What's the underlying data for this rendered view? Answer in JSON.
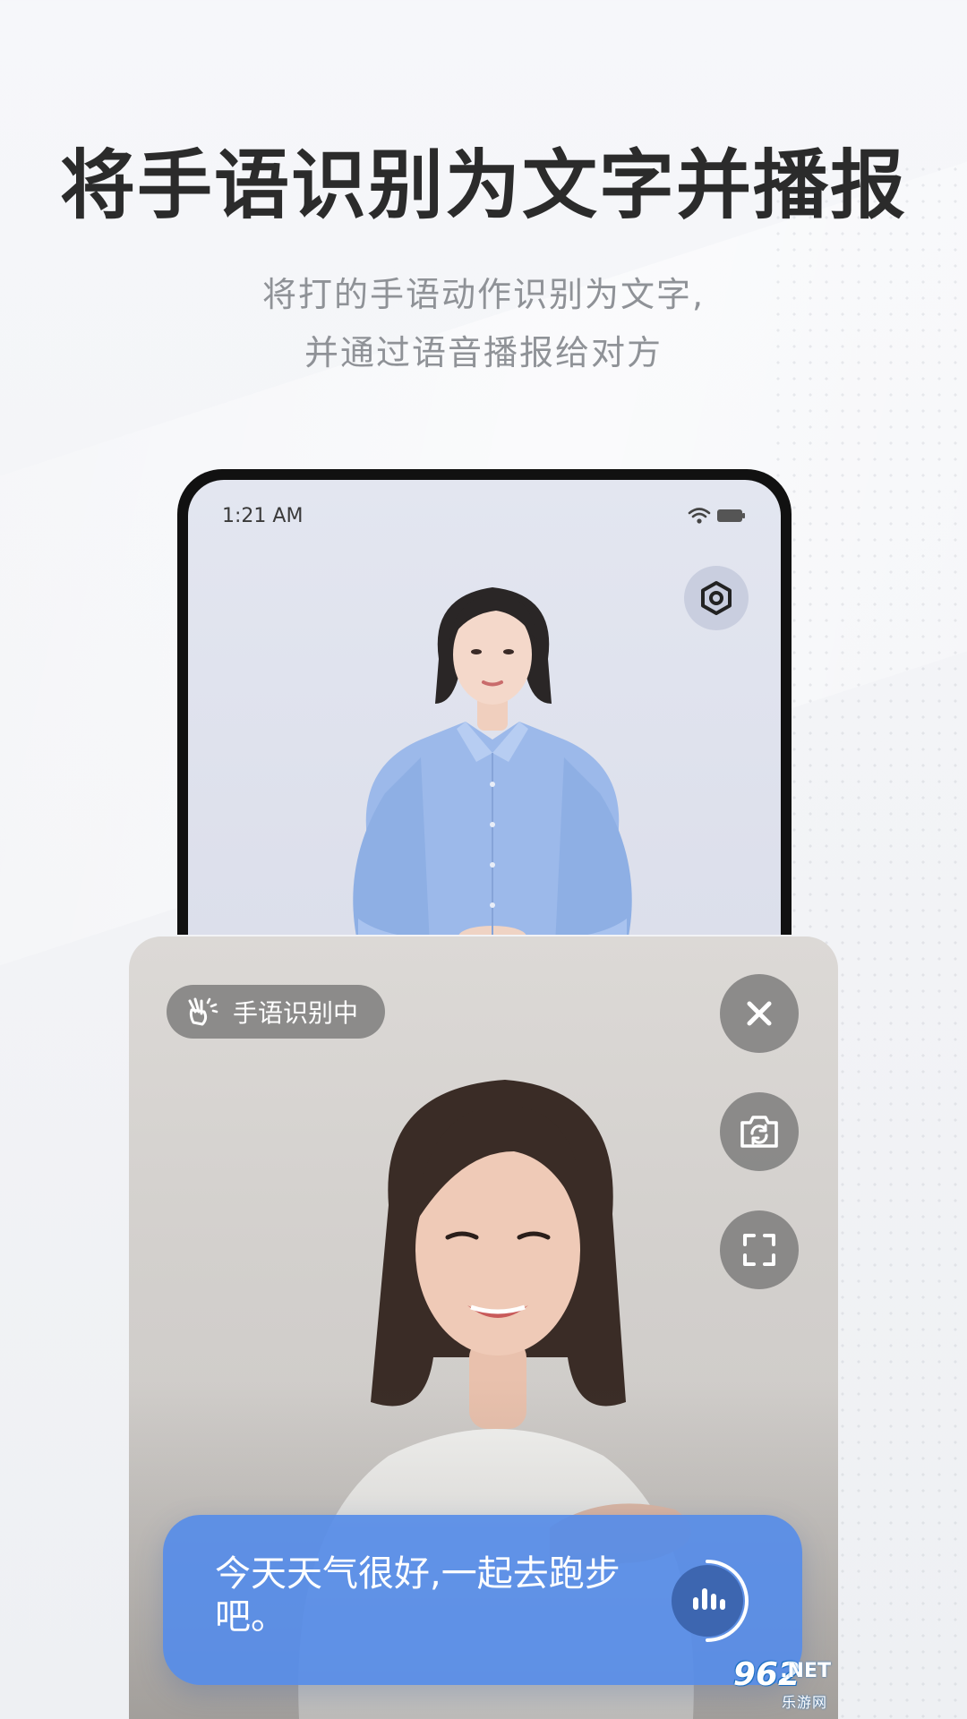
{
  "headline": "将手语识别为文字并播报",
  "subtitle": {
    "line1": "将打的手语动作识别为文字,",
    "line2": "并通过语音播报给对方"
  },
  "phone": {
    "status_time": "1:21 AM",
    "icons": [
      "wifi-icon",
      "battery-icon",
      "settings-icon"
    ]
  },
  "camera": {
    "status_label": "手语识别中",
    "buttons": [
      "close-icon",
      "switch-camera-icon",
      "fullscreen-icon"
    ],
    "caption": "今天天气很好,一起去跑步吧。",
    "voice_icon": "voice-bars-icon"
  },
  "watermark": {
    "number": "962",
    "suffix": ".NET",
    "name": "乐游网"
  },
  "colors": {
    "caption_bg": "#568ce8",
    "headline": "#2b2b2b",
    "subtitle": "#8f9297"
  }
}
